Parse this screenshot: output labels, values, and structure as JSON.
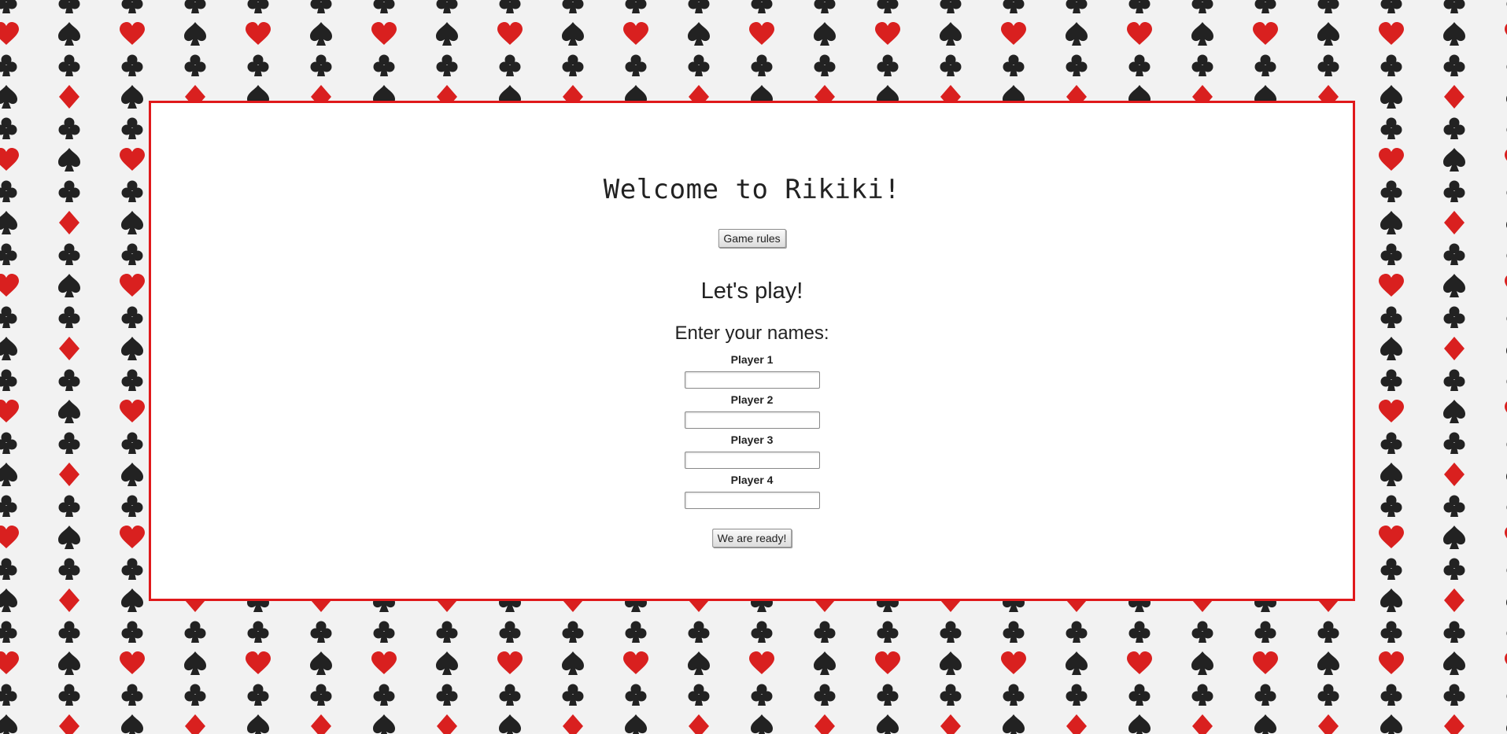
{
  "page": {
    "title": "Welcome to Rikiki!",
    "rules_button_label": "Game rules",
    "subtitle": "Let's play!",
    "prompt": "Enter your names:",
    "players": [
      {
        "label": "Player 1",
        "value": ""
      },
      {
        "label": "Player 2",
        "value": ""
      },
      {
        "label": "Player 3",
        "value": ""
      },
      {
        "label": "Player 4",
        "value": ""
      }
    ],
    "ready_button_label": "We are ready!"
  },
  "background": {
    "pattern": "playing-card-suits",
    "suit_icons": [
      "spade-icon",
      "heart-icon",
      "club-icon",
      "diamond-icon"
    ],
    "black_suit_color": "#222222",
    "red_suit_color": "#d9201f"
  },
  "colors": {
    "panel_border": "#e0191b",
    "panel_background": "#ffffff",
    "page_background": "#f2f2f2"
  }
}
